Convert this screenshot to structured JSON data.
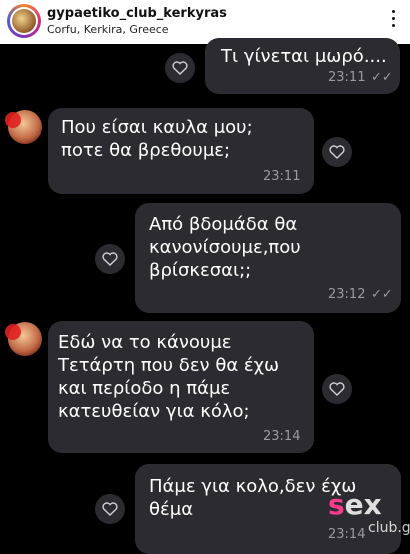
{
  "header": {
    "username": "gypaetiko_club_kerkyras",
    "location": "Corfu, Kerkira, Greece",
    "more_icon": "more-vertical-icon"
  },
  "messages": [
    {
      "side": "out",
      "lines": [
        "Τι γίνεται μωρό...."
      ],
      "time": "23:11",
      "status": "read",
      "reaction_icon": "heart-outline-icon"
    },
    {
      "side": "in",
      "lines": [
        "Που είσαι καυλα μου;",
        "ποτε θα βρεθουμε;"
      ],
      "time": "23:11",
      "reaction_icon": "heart-outline-icon"
    },
    {
      "side": "out",
      "lines": [
        "Από βδομάδα θα",
        "κανονίσουμε,που",
        "βρίσκεσαι;;"
      ],
      "time": "23:12",
      "status": "read",
      "reaction_icon": "heart-outline-icon"
    },
    {
      "side": "in",
      "lines": [
        "Εδώ να το κάνουμε",
        "Τετάρτη που δεν θα έχω",
        "και περίοδο η πάμε",
        "κατευθείαν για κόλο;"
      ],
      "time": "23:14",
      "reaction_icon": "heart-outline-icon"
    },
    {
      "side": "out",
      "lines": [
        "Πάμε για κολο,δεν έχω",
        "θέμα"
      ],
      "time": "23:14",
      "reaction_icon": "heart-outline-icon"
    }
  ],
  "ticks_glyph": "✓✓",
  "watermark": {
    "main_a": "s",
    "main_b": "ex",
    "sub": "club",
    "domain": ".gr"
  },
  "colors": {
    "bubble": "#2b2b31",
    "background": "#000000",
    "time": "#9a9aa2"
  }
}
